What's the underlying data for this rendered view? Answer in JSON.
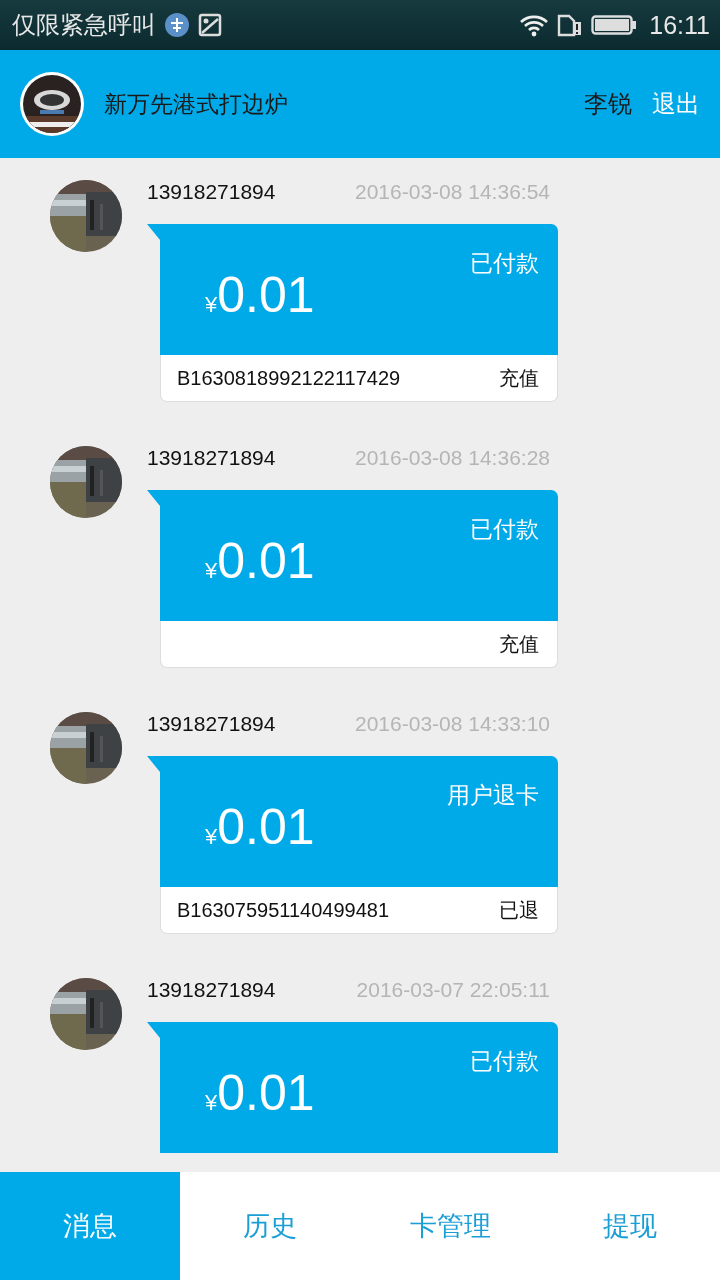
{
  "status_bar": {
    "notification": "仅限紧急呼叫",
    "time": "16:11"
  },
  "header": {
    "shop_name": "新万先港式打边炉",
    "user": "李锐",
    "logout": "退出"
  },
  "messages": [
    {
      "phone": "13918271894",
      "time": "2016-03-08 14:36:54",
      "currency": "¥",
      "amount": "0.01",
      "status": "已付款",
      "order_no": "B1630818992122117429",
      "type": "充值"
    },
    {
      "phone": "13918271894",
      "time": "2016-03-08 14:36:28",
      "currency": "¥",
      "amount": "0.01",
      "status": "已付款",
      "type": "充值"
    },
    {
      "phone": "13918271894",
      "time": "2016-03-08 14:33:10",
      "currency": "¥",
      "amount": "0.01",
      "status": "用户退卡",
      "order_no": "B163075951140499481",
      "type": "已退"
    },
    {
      "phone": "13918271894",
      "time": "2016-03-07 22:05:11",
      "currency": "¥",
      "amount": "0.01",
      "status": "已付款"
    }
  ],
  "tabs": [
    {
      "label": "消息",
      "selected": true
    },
    {
      "label": "历史",
      "selected": false
    },
    {
      "label": "卡管理",
      "selected": false
    },
    {
      "label": "提现",
      "selected": false
    }
  ]
}
